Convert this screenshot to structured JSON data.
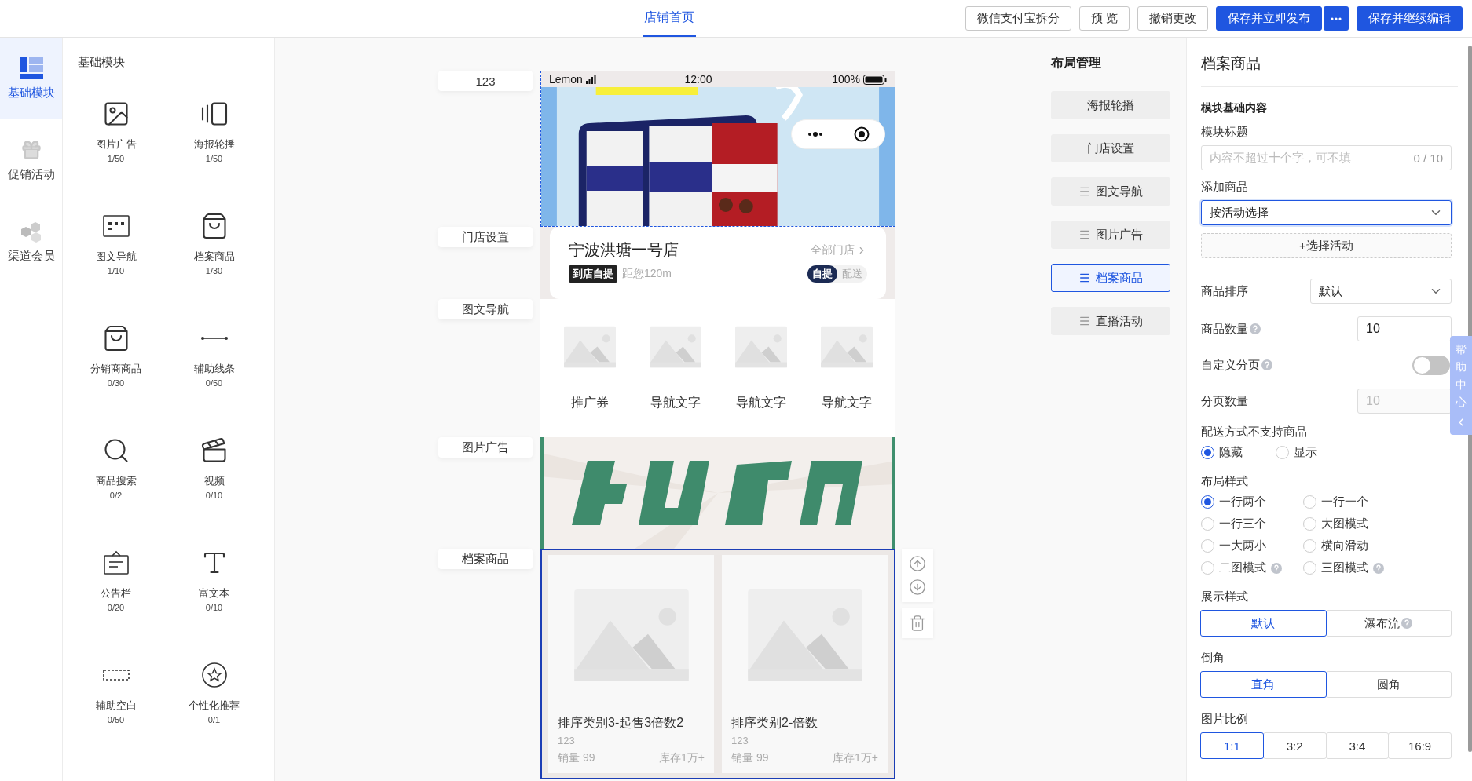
{
  "top_bar": {
    "tabs": [
      {
        "label": "店铺首页",
        "selected": true
      }
    ],
    "buttons": [
      {
        "label": "微信支付宝拆分",
        "kind": "default"
      },
      {
        "label": "预 览",
        "kind": "default"
      },
      {
        "label": "撤销更改",
        "kind": "default"
      },
      {
        "label": "保存并立即发布",
        "kind": "split"
      },
      {
        "label": "保存并继续编辑",
        "kind": "primary"
      }
    ]
  },
  "side_nav": {
    "items": [
      {
        "label": "基础模块",
        "selected": true
      },
      {
        "label": "促销活动",
        "selected": false
      },
      {
        "label": "渠道会员",
        "selected": false
      }
    ]
  },
  "modules": {
    "title": "基础模块",
    "items": [
      {
        "name": "图片广告",
        "count": "1/50"
      },
      {
        "name": "海报轮播",
        "count": "1/50"
      },
      {
        "name": "图文导航",
        "count": "1/10"
      },
      {
        "name": "档案商品",
        "count": "1/30"
      },
      {
        "name": "分销商商品",
        "count": "0/30"
      },
      {
        "name": "辅助线条",
        "count": "0/50"
      },
      {
        "name": "商品搜索",
        "count": "0/2"
      },
      {
        "name": "视频",
        "count": "0/10"
      },
      {
        "name": "公告栏",
        "count": "0/20"
      },
      {
        "name": "富文本",
        "count": "0/10"
      },
      {
        "name": "辅助空白",
        "count": "0/50"
      },
      {
        "name": "个性化推荐",
        "count": "0/1"
      }
    ]
  },
  "phone": {
    "sections": [
      {
        "kind": "banner",
        "label": "123",
        "hovered": true,
        "selected": false,
        "status_bar": {
          "carrier": "Lemon",
          "time": "12:00",
          "battery": "100%"
        }
      },
      {
        "kind": "store",
        "label": "门店设置",
        "hovered": false,
        "selected": false,
        "name": "宁波洪塘一号店",
        "all_stores": "全部门店",
        "tag": "到店自提",
        "distance": "距您120m",
        "modes": [
          {
            "label": "自提",
            "selected": true
          },
          {
            "label": "配送",
            "selected": false
          }
        ]
      },
      {
        "kind": "nav",
        "label": "图文导航",
        "hovered": false,
        "selected": false,
        "items": [
          "推广券",
          "导航文字",
          "导航文字",
          "导航文字"
        ]
      },
      {
        "kind": "image_ad",
        "label": "图片广告",
        "hovered": false,
        "selected": false
      },
      {
        "kind": "goods",
        "label": "档案商品",
        "hovered": false,
        "selected": true,
        "products": [
          {
            "name": "排序类别3-起售3倍数2",
            "subtitle": "123",
            "sales": "销量 99",
            "stock": "库存1万+"
          },
          {
            "name": "排序类别2-倍数",
            "subtitle": "123",
            "sales": "销量 99",
            "stock": "库存1万+"
          }
        ]
      }
    ]
  },
  "layout_manager": {
    "title": "布局管理",
    "items": [
      {
        "label": "海报轮播",
        "draggable": false,
        "selected": false
      },
      {
        "label": "门店设置",
        "draggable": false,
        "selected": false
      },
      {
        "label": "图文导航",
        "draggable": true,
        "selected": false
      },
      {
        "label": "图片广告",
        "draggable": true,
        "selected": false
      },
      {
        "label": "档案商品",
        "draggable": true,
        "selected": true
      },
      {
        "label": "直播活动",
        "draggable": true,
        "selected": false
      }
    ]
  },
  "settings": {
    "title": "档案商品",
    "section_title": "模块基础内容",
    "fields": [
      {
        "kind": "text",
        "label": "模块标题",
        "placeholder": "内容不超过十个字，可不填",
        "counter": "0 / 10"
      },
      {
        "kind": "select",
        "label": "添加商品",
        "value": "按活动选择",
        "focused": true
      },
      {
        "kind": "add_button",
        "label": "+选择活动"
      },
      {
        "kind": "inline_select",
        "label": "商品排序",
        "value": "默认"
      },
      {
        "kind": "inline_number",
        "label": "商品数量",
        "help": true,
        "value": "10",
        "disabled": false
      },
      {
        "kind": "toggle",
        "label": "自定义分页",
        "help": true,
        "on": false
      },
      {
        "kind": "inline_number",
        "label": "分页数量",
        "help": false,
        "value": "10",
        "disabled": true
      },
      {
        "kind": "radio",
        "label": "配送方式不支持商品",
        "options": [
          {
            "label": "隐藏",
            "selected": true,
            "help": false
          },
          {
            "label": "显示",
            "selected": false,
            "help": false
          }
        ]
      },
      {
        "kind": "radio_grid",
        "label": "布局样式",
        "options": [
          {
            "label": "一行两个",
            "selected": true,
            "help": false
          },
          {
            "label": "一行一个",
            "selected": false,
            "help": false
          },
          {
            "label": "一行三个",
            "selected": false,
            "help": false
          },
          {
            "label": "大图模式",
            "selected": false,
            "help": false
          },
          {
            "label": "一大两小",
            "selected": false,
            "help": false
          },
          {
            "label": "横向滑动",
            "selected": false,
            "help": false
          },
          {
            "label": "二图模式",
            "selected": false,
            "help": true
          },
          {
            "label": "三图模式",
            "selected": false,
            "help": true
          }
        ]
      },
      {
        "kind": "segmented",
        "label": "展示样式",
        "options": [
          {
            "label": "默认",
            "selected": true,
            "help": false
          },
          {
            "label": "瀑布流",
            "selected": false,
            "help": true
          }
        ]
      },
      {
        "kind": "segmented",
        "label": "倒角",
        "options": [
          {
            "label": "直角",
            "selected": true,
            "help": false
          },
          {
            "label": "圆角",
            "selected": false,
            "help": false
          }
        ]
      },
      {
        "kind": "segmented",
        "label": "图片比例",
        "options": [
          {
            "label": "1:1",
            "selected": true,
            "help": false
          },
          {
            "label": "3:2",
            "selected": false,
            "help": false
          },
          {
            "label": "3:4",
            "selected": false,
            "help": false
          },
          {
            "label": "16:9",
            "selected": false,
            "help": false
          }
        ]
      }
    ]
  },
  "help_tab": {
    "label": "帮助中心"
  }
}
